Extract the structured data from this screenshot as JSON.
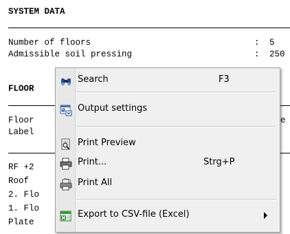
{
  "document": {
    "heading_system": "SYSTEM DATA",
    "rows": [
      {
        "label": "Number of floors",
        "sep": ":",
        "value": "5"
      },
      {
        "label": "Admissible soil pressing",
        "sep": ":",
        "value": "250"
      }
    ],
    "heading_floor": "FLOOR",
    "floor_header": [
      "Floor",
      "Label"
    ],
    "floor_header_right": "e",
    "floor_rows": [
      "RF +2",
      "Roof",
      "2. Flo",
      "1. Flo",
      "Plate"
    ]
  },
  "context_menu": {
    "items": [
      {
        "label": "Search",
        "shortcut": "F3",
        "icon": "binoculars-icon"
      },
      {
        "label": "Output settings",
        "shortcut": "",
        "icon": "output-settings-icon"
      },
      {
        "label": "Print Preview",
        "shortcut": "",
        "icon": "print-preview-icon"
      },
      {
        "label": "Print...",
        "shortcut": "Strg+P",
        "icon": "printer-icon"
      },
      {
        "label": "Print All",
        "shortcut": "",
        "icon": "print-all-icon"
      },
      {
        "label": "Export to CSV-file (Excel)",
        "shortcut": "",
        "icon": "excel-export-icon",
        "has_submenu": true
      }
    ]
  }
}
